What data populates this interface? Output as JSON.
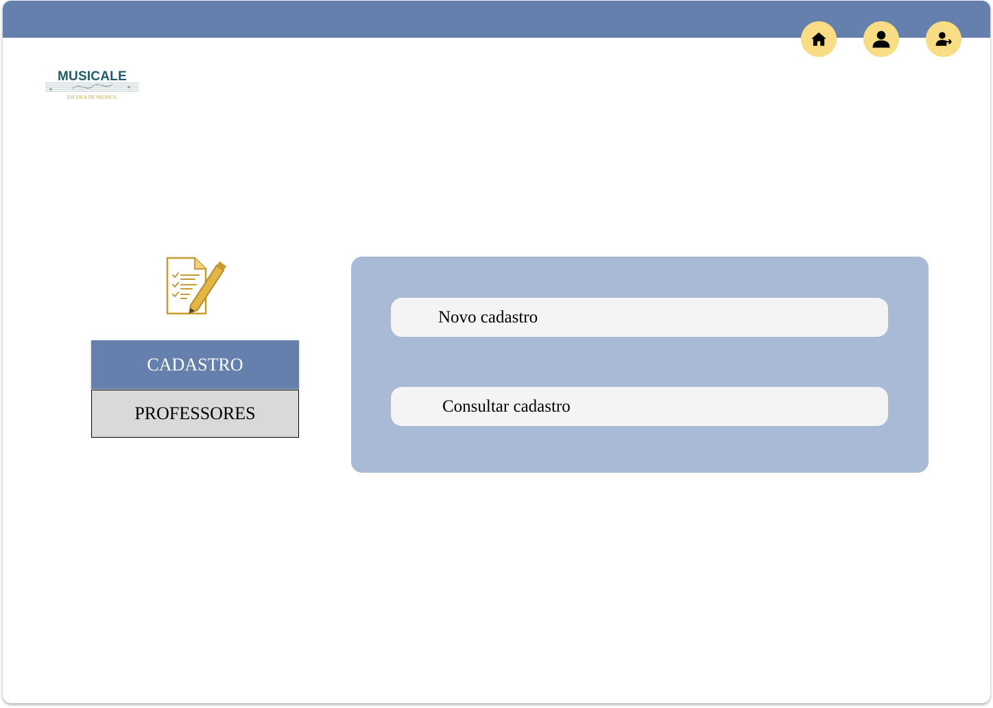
{
  "header": {
    "home_icon": "home-icon",
    "profile_icon": "user-icon",
    "logout_icon": "user-logout-icon",
    "bar_color": "#6680ad",
    "icon_bg_color": "#f9dd85"
  },
  "logo": {
    "title": "MUSICALE",
    "subtitle": "ESCOLA DE MUSICA"
  },
  "sidebar": {
    "icon": "checklist-pencil-icon",
    "active_label": "CADASTRO",
    "item_label": "PROFESSORES"
  },
  "panel": {
    "new_label": "Novo cadastro",
    "consult_label": "Consultar cadastro",
    "panel_color": "#a8bad6"
  }
}
